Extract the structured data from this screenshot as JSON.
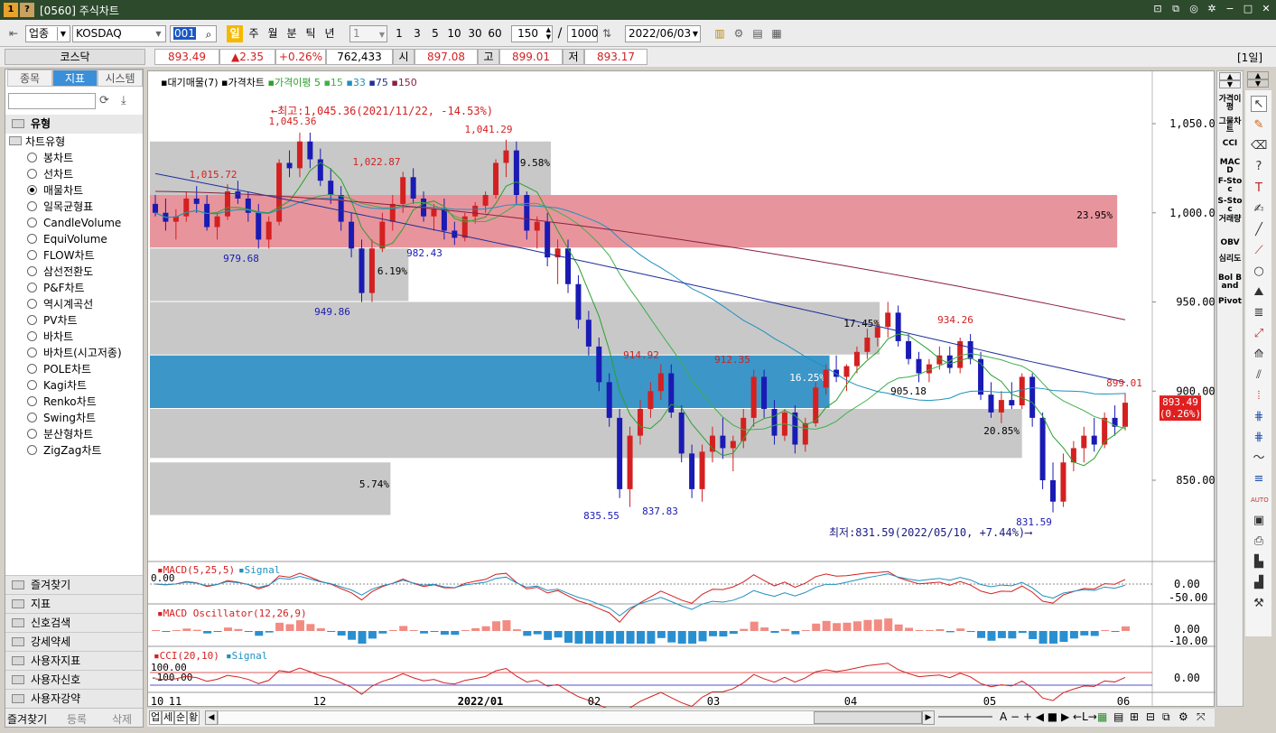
{
  "window": {
    "title": "[0560] 주식차트",
    "icon1": "1",
    "icon2": "?"
  },
  "toolbar": {
    "category": "업종",
    "market": "KOSDAQ",
    "code": "001",
    "periods": [
      "일",
      "주",
      "월",
      "분",
      "틱",
      "년"
    ],
    "interval_select": "1",
    "quick": [
      "1",
      "3",
      "5",
      "10",
      "30",
      "60"
    ],
    "count": "150",
    "slash": "/",
    "total": "1000",
    "date": "2022/06/03"
  },
  "infobar": {
    "name": "코스닥",
    "price": "893.49",
    "change": "▲2.35",
    "pct": "+0.26%",
    "volume": "762,433",
    "open_label": "시",
    "open": "897.08",
    "high_label": "고",
    "high": "899.01",
    "low_label": "저",
    "low": "893.17",
    "period_label": "[1일]"
  },
  "left": {
    "tabs": [
      "종목",
      "지표",
      "시스템"
    ],
    "group_title": "유형",
    "parent": "차트유형",
    "items": [
      "봉차트",
      "선차트",
      "매물차트",
      "일목균형표",
      "CandleVolume",
      "EquiVolume",
      "FLOW차트",
      "삼선전환도",
      "P&F차트",
      "역시계곡선",
      "PV차트",
      "바차트",
      "바차트(시고저종)",
      "POLE차트",
      "Kagi차트",
      "Renko차트",
      "Swing차트",
      "분산형차트",
      "ZigZag차트"
    ],
    "selected_index": 2,
    "folders": [
      "즐겨찾기",
      "지표",
      "신호검색",
      "강세약세",
      "사용자지표",
      "사용자신호",
      "사용자강약"
    ],
    "bottom_tabs": [
      "즐겨찾기",
      "등록",
      "삭제"
    ]
  },
  "legend": {
    "items": [
      "대기매물(7)",
      "가격차트",
      "가격이평",
      "5",
      "15",
      "33",
      "75",
      "150"
    ]
  },
  "colors": {
    "up": "#d42020",
    "down": "#1a1ab4",
    "ma5": "#2ca02c",
    "ma15": "#3fb04a",
    "ma33": "#1e90c0",
    "ma75": "#1f2f9a",
    "ma150": "#8b2040",
    "profile_gray": "#c8c8c8",
    "profile_red": "#e8949c",
    "profile_blue": "#3c96c8",
    "last_price_bg": "#e02020"
  },
  "annotations": {
    "high_arrow": "←최고:1,045.36(2021/11/22, -14.53%)",
    "low_arrow": "최저:831.59(2022/05/10, +7.44%)⟶",
    "labels": [
      "1,045.36",
      "1,041.29",
      "1,022.87",
      "1,015.72",
      "979.68",
      "949.86",
      "982.43",
      "914.92",
      "912.35",
      "934.26",
      "905.18",
      "835.55",
      "837.83",
      "831.59",
      "899.01"
    ],
    "pct": [
      "9.58%",
      "23.95%",
      "6.19%",
      "17.45%",
      "16.25%",
      "20.85%",
      "5.74%"
    ]
  },
  "price_axis": [
    "1,050.00",
    "1,000.00",
    "950.00",
    "900.00",
    "850.00"
  ],
  "last_price": {
    "value": "893.49",
    "pct": "(0.26%)"
  },
  "chart_data": {
    "type": "candlestick",
    "profile_bars": [
      {
        "range": [
          1005,
          1040
        ],
        "pct": "9.58%"
      },
      {
        "range": [
          980,
          1010
        ],
        "pct": "23.95%"
      },
      {
        "range": [
          950,
          980
        ],
        "pct": "6.19%"
      },
      {
        "range": [
          920,
          950
        ],
        "pct": "17.45%"
      },
      {
        "range": [
          890,
          920
        ],
        "pct": "16.25%"
      },
      {
        "range": [
          862,
          890
        ],
        "pct": "20.85%"
      },
      {
        "range": [
          830,
          860
        ],
        "pct": "5.74%"
      }
    ],
    "ohlc": [
      [
        1005,
        1010,
        998,
        1000
      ],
      [
        1000,
        1008,
        990,
        995
      ],
      [
        995,
        1002,
        985,
        998
      ],
      [
        998,
        1012,
        995,
        1008
      ],
      [
        1008,
        1015,
        1000,
        1005
      ],
      [
        1005,
        1010,
        990,
        992
      ],
      [
        992,
        1000,
        985,
        998
      ],
      [
        998,
        1016,
        996,
        1012
      ],
      [
        1012,
        1018,
        1005,
        1008
      ],
      [
        1008,
        1012,
        995,
        1000
      ],
      [
        1000,
        1005,
        980,
        985
      ],
      [
        985,
        998,
        980,
        995
      ],
      [
        995,
        1030,
        993,
        1028
      ],
      [
        1028,
        1035,
        1020,
        1025
      ],
      [
        1025,
        1045,
        1020,
        1040
      ],
      [
        1040,
        1045,
        1025,
        1030
      ],
      [
        1030,
        1036,
        1015,
        1018
      ],
      [
        1018,
        1025,
        1005,
        1010
      ],
      [
        1010,
        1015,
        990,
        995
      ],
      [
        995,
        1000,
        975,
        980
      ],
      [
        980,
        985,
        950,
        955
      ],
      [
        955,
        985,
        950,
        980
      ],
      [
        980,
        1000,
        978,
        995
      ],
      [
        995,
        1010,
        990,
        1005
      ],
      [
        1005,
        1023,
        1000,
        1020
      ],
      [
        1020,
        1025,
        1005,
        1008
      ],
      [
        1008,
        1012,
        995,
        998
      ],
      [
        998,
        1005,
        990,
        1002
      ],
      [
        1002,
        1008,
        985,
        990
      ],
      [
        990,
        995,
        982,
        986
      ],
      [
        986,
        1000,
        984,
        998
      ],
      [
        998,
        1006,
        994,
        1004
      ],
      [
        1004,
        1012,
        1000,
        1010
      ],
      [
        1010,
        1030,
        1008,
        1028
      ],
      [
        1028,
        1041,
        1020,
        1035
      ],
      [
        1035,
        1040,
        1005,
        1010
      ],
      [
        1010,
        1012,
        985,
        990
      ],
      [
        990,
        998,
        980,
        995
      ],
      [
        995,
        1000,
        970,
        975
      ],
      [
        975,
        985,
        960,
        980
      ],
      [
        980,
        985,
        955,
        960
      ],
      [
        960,
        965,
        935,
        940
      ],
      [
        940,
        945,
        920,
        925
      ],
      [
        925,
        930,
        900,
        905
      ],
      [
        905,
        910,
        880,
        885
      ],
      [
        885,
        890,
        840,
        845
      ],
      [
        845,
        880,
        835,
        875
      ],
      [
        875,
        895,
        870,
        890
      ],
      [
        890,
        905,
        885,
        900
      ],
      [
        900,
        915,
        895,
        910
      ],
      [
        910,
        915,
        885,
        888
      ],
      [
        888,
        892,
        860,
        865
      ],
      [
        865,
        870,
        840,
        845
      ],
      [
        845,
        870,
        838,
        866
      ],
      [
        866,
        880,
        860,
        875
      ],
      [
        875,
        885,
        862,
        868
      ],
      [
        868,
        875,
        855,
        872
      ],
      [
        872,
        890,
        868,
        885
      ],
      [
        885,
        912,
        880,
        908
      ],
      [
        908,
        912,
        885,
        890
      ],
      [
        890,
        895,
        870,
        875
      ],
      [
        875,
        890,
        872,
        888
      ],
      [
        888,
        892,
        865,
        870
      ],
      [
        870,
        885,
        866,
        882
      ],
      [
        882,
        905,
        880,
        902
      ],
      [
        902,
        915,
        898,
        912
      ],
      [
        912,
        920,
        905,
        908
      ],
      [
        908,
        915,
        900,
        914
      ],
      [
        914,
        925,
        910,
        922
      ],
      [
        922,
        935,
        918,
        930
      ],
      [
        930,
        940,
        925,
        936
      ],
      [
        936,
        950,
        930,
        944
      ],
      [
        944,
        948,
        925,
        928
      ],
      [
        928,
        932,
        915,
        918
      ],
      [
        918,
        922,
        905,
        910
      ],
      [
        910,
        918,
        905,
        915
      ],
      [
        915,
        925,
        912,
        920
      ],
      [
        920,
        925,
        910,
        913
      ],
      [
        913,
        930,
        910,
        928
      ],
      [
        928,
        932,
        915,
        918
      ],
      [
        918,
        922,
        895,
        898
      ],
      [
        898,
        905,
        885,
        888
      ],
      [
        888,
        900,
        882,
        895
      ],
      [
        895,
        905,
        890,
        892
      ],
      [
        892,
        910,
        890,
        908
      ],
      [
        908,
        910,
        880,
        885
      ],
      [
        885,
        888,
        845,
        850
      ],
      [
        850,
        860,
        832,
        838
      ],
      [
        838,
        865,
        835,
        860
      ],
      [
        860,
        872,
        855,
        868
      ],
      [
        868,
        880,
        860,
        875
      ],
      [
        875,
        885,
        866,
        870
      ],
      [
        870,
        888,
        868,
        885
      ],
      [
        885,
        892,
        875,
        880
      ],
      [
        880,
        899,
        878,
        893.49
      ]
    ]
  },
  "subcharts": [
    {
      "legend": "MACD(5,25,5)",
      "legend2": "Signal",
      "axis": [
        "0.00",
        "-50.00"
      ],
      "left_label": "0.00"
    },
    {
      "legend": "MACD Oscillator(12,26,9)",
      "axis": [
        "0.00",
        "-10.00"
      ]
    },
    {
      "legend": "CCI(20,10)",
      "legend2": "Signal",
      "axis": [
        "0.00"
      ],
      "left_labels": [
        "100.00",
        "-100.00"
      ]
    }
  ],
  "x_axis": [
    "10",
    "11",
    "12",
    "2022/01",
    "02",
    "03",
    "04",
    "05",
    "06"
  ],
  "right_indicators": [
    "가격이평",
    "그물차트",
    "CCI",
    "MACD",
    "F-Stoc",
    "S-Stoc",
    "거래량",
    "OBV",
    "심리도",
    "Bol Band",
    "Pivot"
  ],
  "bottom": {
    "tabs": [
      "업",
      "세",
      "순",
      "황"
    ],
    "controls": "A − + ◀ ■ ▶ ←L→"
  }
}
